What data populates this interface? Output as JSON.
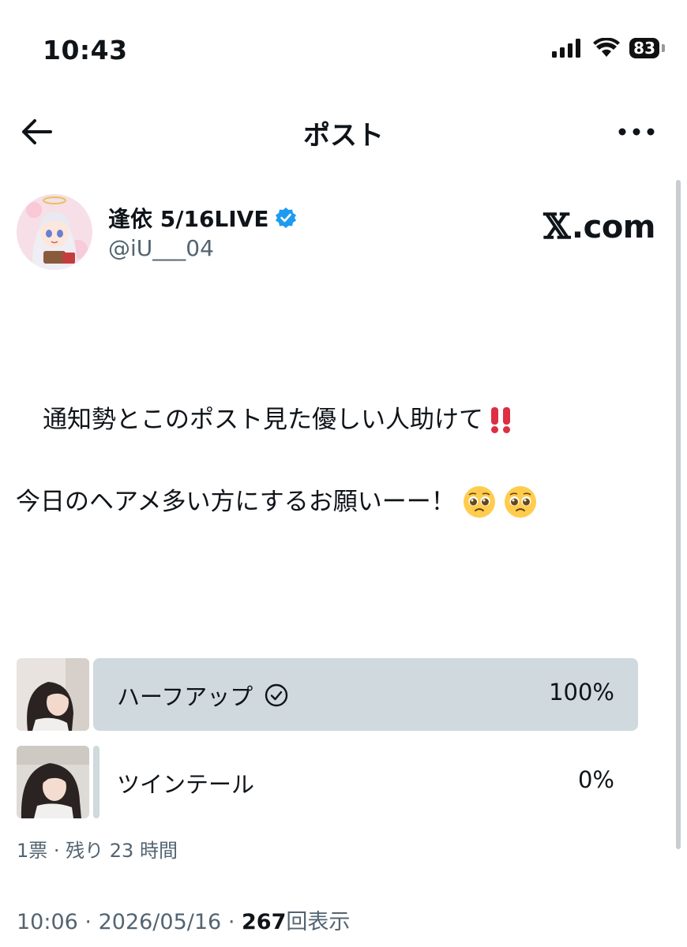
{
  "status_bar": {
    "time": "10:43",
    "battery": "83",
    "icons": [
      "cellular-signal-icon",
      "wifi-icon",
      "battery-icon"
    ]
  },
  "header": {
    "title": "ポスト",
    "back_icon": "arrow-left-icon",
    "more_icon": "more-horizontal-icon"
  },
  "author": {
    "name": "逢依 5/16LIVE",
    "handle": "@iU___04",
    "verified": true,
    "avatar": "anime-avatar"
  },
  "watermark": {
    "mark": "𝕏",
    "text": ".com"
  },
  "post": {
    "line1": "通知勢とこのポスト見た優しい人助けて",
    "line1_emoji": "double-exclamation-emoji",
    "line2": "今日のヘアメ多い方にするお願いーー！",
    "line2_emoji": [
      "pleading-face-emoji",
      "pleading-face-emoji"
    ]
  },
  "poll": {
    "options": [
      {
        "label": "ハーフアップ",
        "percent": "100%",
        "fraction": 1.0,
        "selected": true,
        "thumbnail": "half-up-hairstyle-photo"
      },
      {
        "label": "ツインテール",
        "percent": "0%",
        "fraction": 0.0,
        "selected": false,
        "thumbnail": "twin-tail-hairstyle-photo"
      }
    ],
    "summary": "1票 · 残り 23 時間"
  },
  "meta": {
    "time": "10:06",
    "date": "2026/05/16",
    "views_count": "267",
    "views_label": "回表示",
    "separator": "·"
  },
  "colors": {
    "text": "#0f1419",
    "secondary": "#536471",
    "poll_fill": "#cfd9de",
    "verified_badge": "#1d9bf0"
  }
}
